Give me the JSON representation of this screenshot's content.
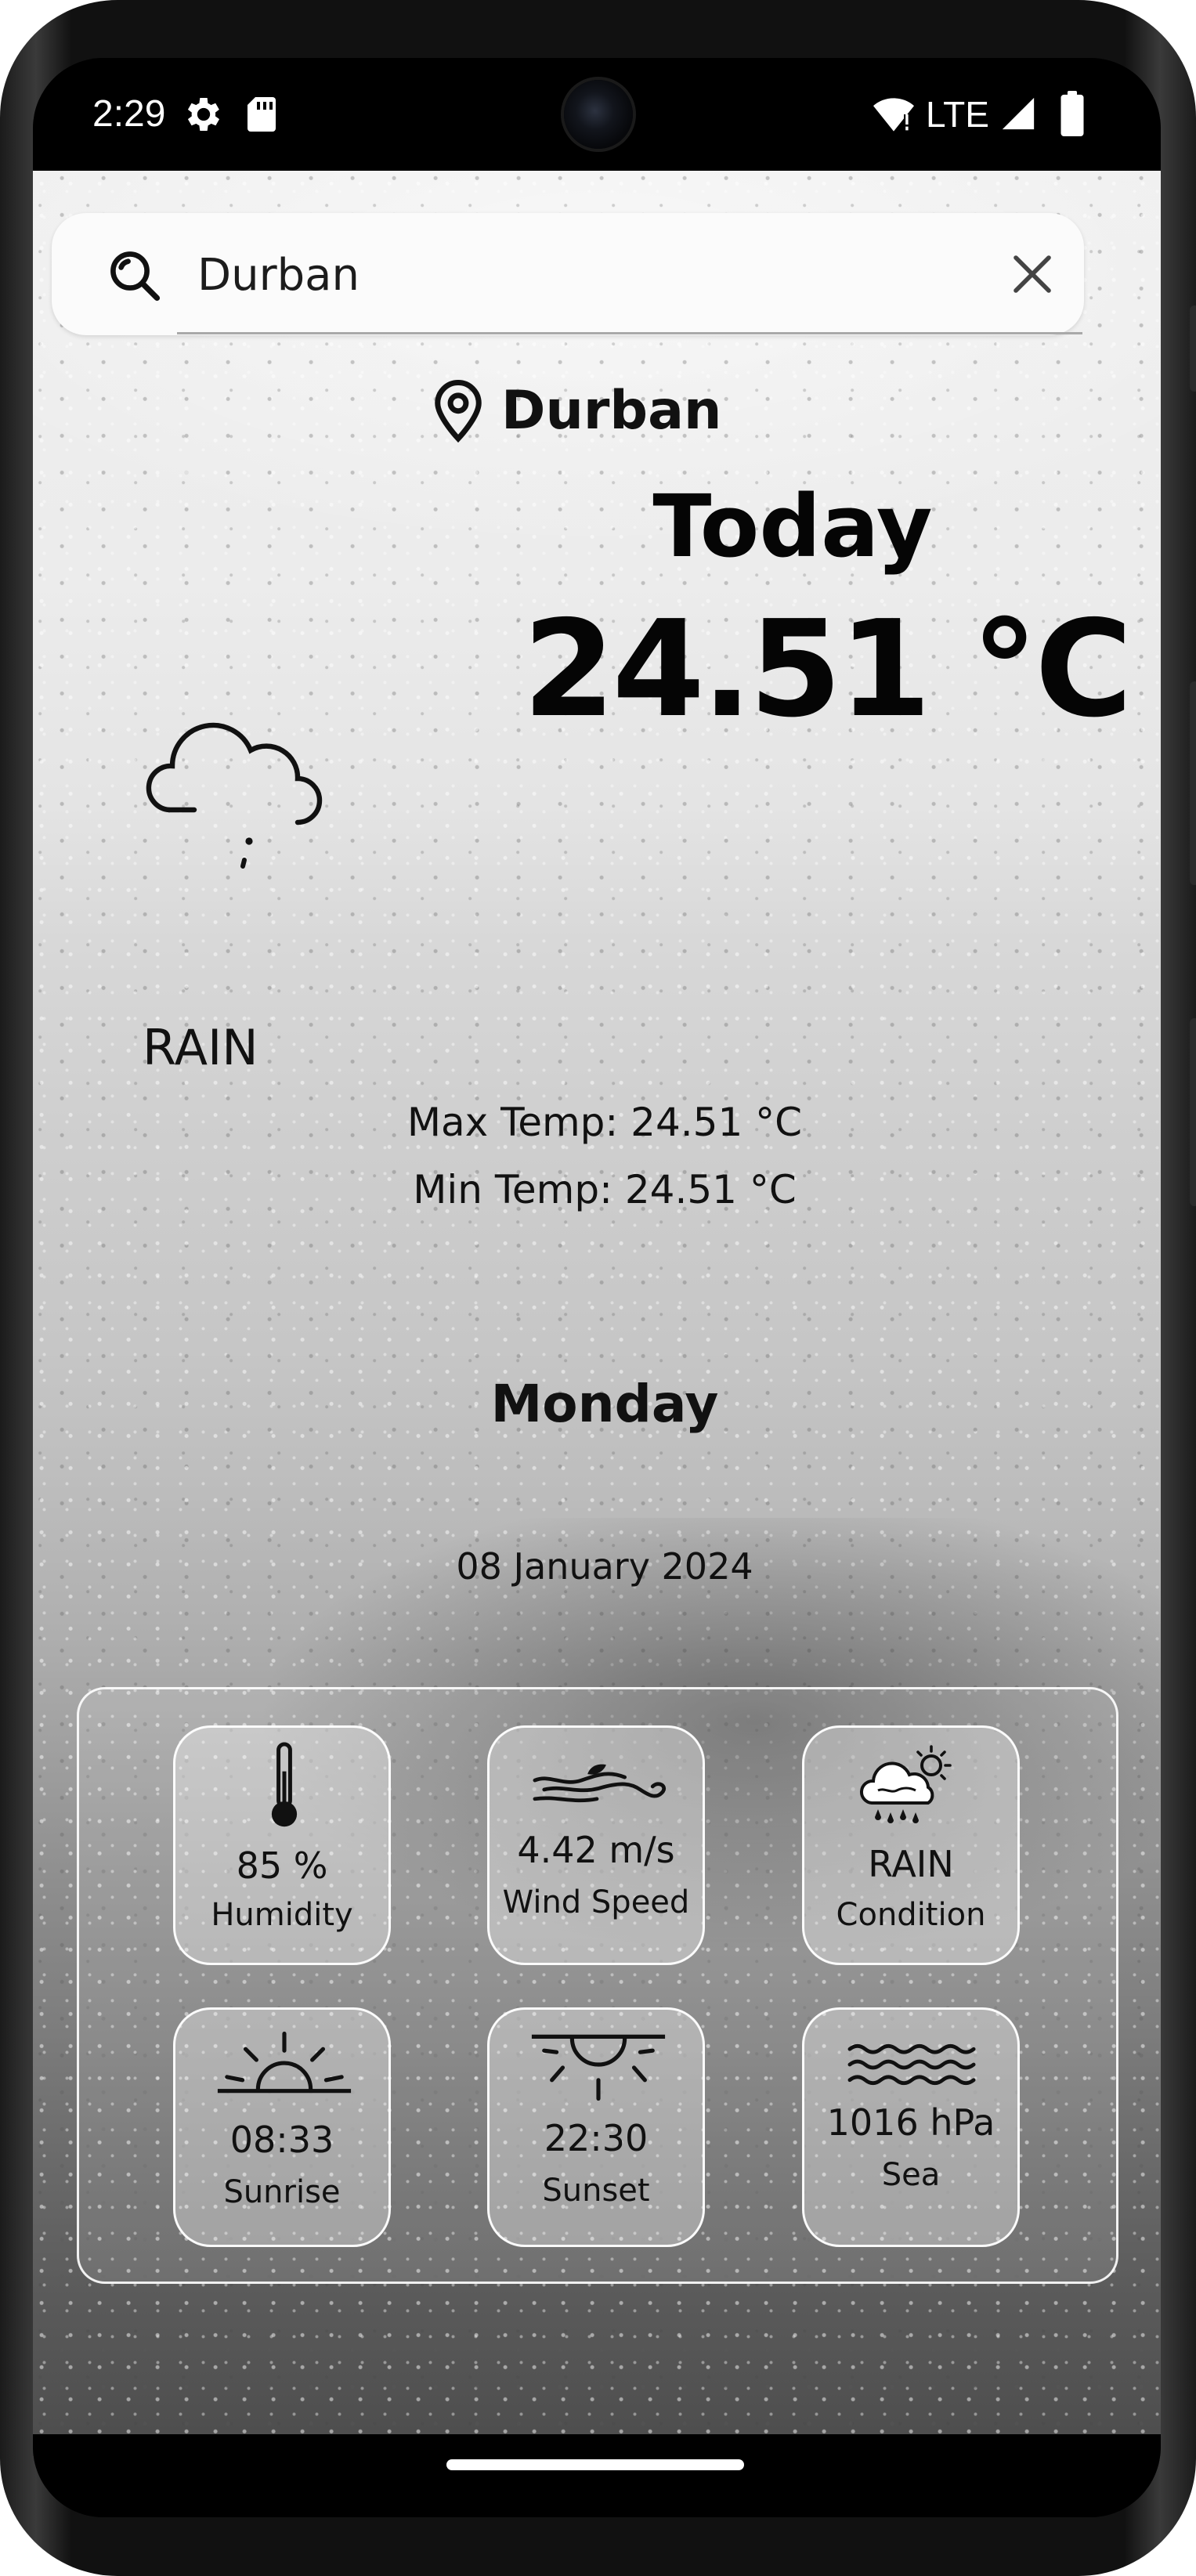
{
  "status_bar": {
    "time": "2:29",
    "network": "LTE",
    "icons": [
      "gear-icon",
      "sd-card-icon",
      "wifi-icon",
      "signal-icon",
      "battery-icon"
    ]
  },
  "search": {
    "value": "Durban",
    "icon": "search-icon",
    "clear_icon": "close-icon"
  },
  "location": {
    "name": "Durban",
    "icon": "location-pin-icon"
  },
  "current": {
    "heading": "Today",
    "temperature": "24.51 °C",
    "condition": "RAIN",
    "condition_icon": "cloud-rain-icon",
    "max_temp": "Max Temp: 24.51 °C",
    "min_temp": "Min Temp: 24.51 °C",
    "day": "Monday",
    "date": "08 January 2024"
  },
  "details": [
    {
      "value": "85 %",
      "label": "Humidity",
      "icon": "thermometer-icon"
    },
    {
      "value": "4.42 m/s",
      "label": "Wind Speed",
      "icon": "wind-icon"
    },
    {
      "value": "RAIN",
      "label": "Condition",
      "icon": "cloud-sun-rain-icon"
    },
    {
      "value": "08:33",
      "label": "Sunrise",
      "icon": "sunrise-icon"
    },
    {
      "value": "22:30",
      "label": "Sunset",
      "icon": "sunset-icon"
    },
    {
      "value": "1016 hPa",
      "label": "Sea",
      "icon": "waves-icon"
    }
  ],
  "colors": {
    "text": "#111111",
    "status_bar": "#000000",
    "panel_border": "#ffffff"
  }
}
